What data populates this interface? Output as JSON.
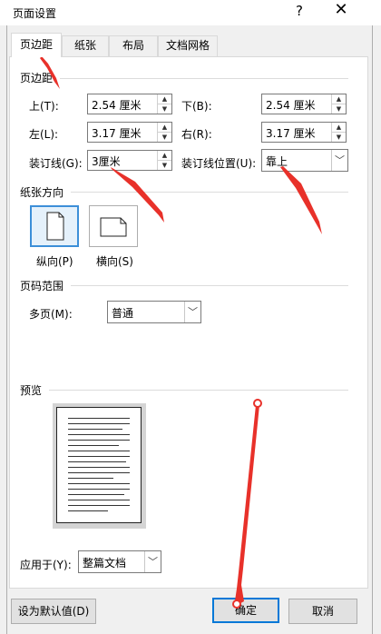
{
  "window": {
    "title": "页面设置",
    "help": "?",
    "close": "✕"
  },
  "tabs": [
    {
      "label": "页边距",
      "active": true
    },
    {
      "label": "纸张",
      "active": false
    },
    {
      "label": "布局",
      "active": false
    },
    {
      "label": "文档网格",
      "active": false
    }
  ],
  "margins": {
    "section_label": "页边距",
    "top_label": "上(T):",
    "top_value": "2.54 厘米",
    "bottom_label": "下(B):",
    "bottom_value": "2.54 厘米",
    "left_label": "左(L):",
    "left_value": "3.17 厘米",
    "right_label": "右(R):",
    "right_value": "3.17 厘米",
    "gutter_label": "装订线(G):",
    "gutter_value": "3厘米",
    "gutter_pos_label": "装订线位置(U):",
    "gutter_pos_value": "靠上"
  },
  "orientation": {
    "section_label": "纸张方向",
    "portrait_label": "纵向(P)",
    "landscape_label": "横向(S)",
    "selected": "portrait"
  },
  "pages": {
    "section_label": "页码范围",
    "multiple_label": "多页(M):",
    "multiple_value": "普通"
  },
  "preview": {
    "section_label": "预览",
    "apply_label": "应用于(Y):",
    "apply_value": "整篇文档"
  },
  "buttons": {
    "set_default": "设为默认值(D)",
    "ok": "确定",
    "cancel": "取消"
  },
  "annotation_color": "#e8312a"
}
